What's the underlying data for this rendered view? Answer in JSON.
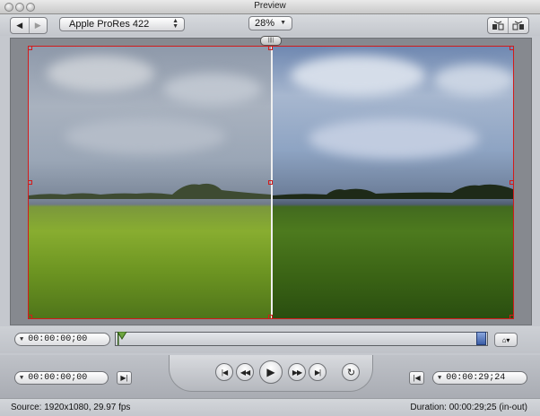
{
  "window": {
    "title": "Preview"
  },
  "toolbar": {
    "back_icon": "back-arrow-icon",
    "forward_icon": "forward-arrow-icon",
    "codec": "Apple ProRes 422",
    "zoom": "28%"
  },
  "viewer": {
    "split_handle_icon": "split-handle-icon"
  },
  "timeline": {
    "current_timecode": "00:00:00;00"
  },
  "transport": {
    "in_timecode": "00:00:00;00",
    "out_timecode": "00:00:29;24"
  },
  "status": {
    "source": "Source: 1920x1080, 29.97 fps",
    "duration": "Duration: 00:00:29;25 (in-out)"
  },
  "colors": {
    "crop_frame": "#d21b1b",
    "out_marker": "#3c5ea8",
    "in_marker": "#6ea640"
  }
}
